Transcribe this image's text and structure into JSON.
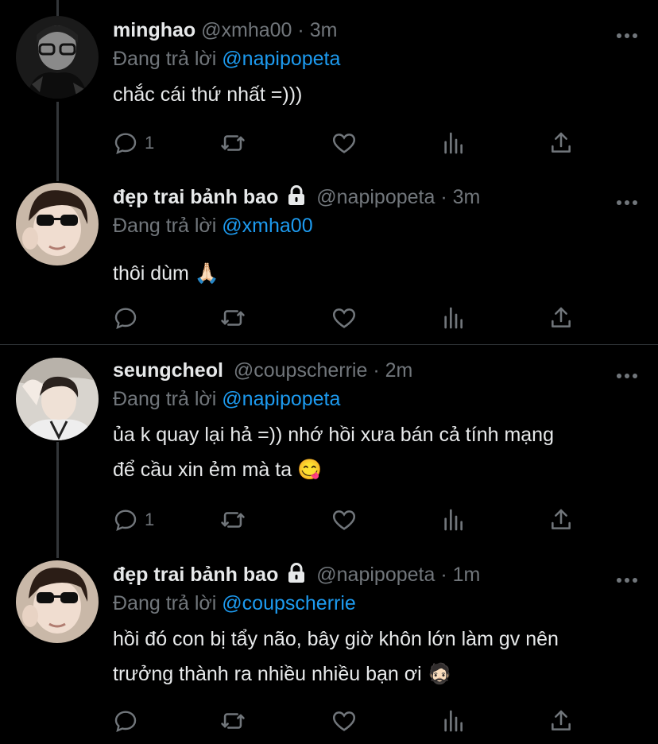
{
  "tweets": [
    {
      "name": "minghao",
      "handle": "@xmha00",
      "sep": "·",
      "time": "3m",
      "replying_prefix": "Đang trả lời",
      "replying_to": "@napipopeta",
      "text": [
        "chắc cái thứ nhất =)))"
      ],
      "reply_count": "1",
      "locked": false
    },
    {
      "name": "đẹp trai bảnh bao",
      "handle": "@napipopeta",
      "sep": "·",
      "time": "3m",
      "replying_prefix": "Đang trả lời",
      "replying_to": "@xmha00",
      "text": [
        "thôi dùm 🙏🏻"
      ],
      "reply_count": "",
      "locked": true
    },
    {
      "name": "seungcheol",
      "handle": "@coupscherrie",
      "sep": "·",
      "time": "2m",
      "replying_prefix": "Đang trả lời",
      "replying_to": "@napipopeta",
      "text": [
        "ủa k quay lại hả =)) nhớ hồi xưa bán cả tính mạng",
        "để cầu xin ẻm mà ta 😋"
      ],
      "reply_count": "1",
      "locked": false
    },
    {
      "name": "đẹp trai bảnh bao",
      "handle": "@napipopeta",
      "sep": "·",
      "time": "1m",
      "replying_prefix": "Đang trả lời",
      "replying_to": "@coupscherrie",
      "text": [
        "hồi đó con bị tẩy não, bây giờ khôn lớn làm gv nên",
        "trưởng thành ra nhiều nhiều bạn ơi 🧔🏻"
      ],
      "reply_count": "",
      "locked": true
    }
  ],
  "icons": {
    "reply": "reply-icon",
    "retweet": "retweet-icon",
    "like": "heart-icon",
    "views": "views-icon",
    "share": "share-icon",
    "more": "more-icon",
    "lock": "lock-icon"
  },
  "colors": {
    "background": "#000000",
    "primary_text": "#e7e9ea",
    "secondary_text": "#71767b",
    "mention": "#1d9bf0"
  }
}
